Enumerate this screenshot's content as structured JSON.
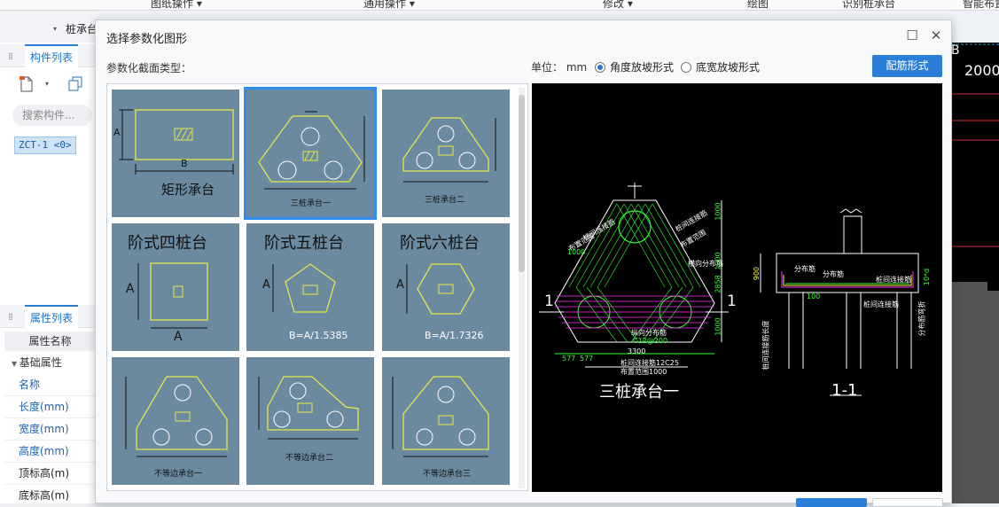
{
  "menubar": {
    "items": [
      "图纸操作",
      "通用操作",
      "修改",
      "绘图",
      "识别桩承台",
      "智能布置"
    ]
  },
  "subbar": {
    "title": "桩承台"
  },
  "left_panel": {
    "component_tab": "构件列表",
    "search_placeholder": "搜索构件...",
    "selected_component": "ZCT-1 <0>",
    "property_tab": "属性列表",
    "property_header": "属性名称",
    "property_group": "基础属性",
    "properties": [
      "名称",
      "长度(mm)",
      "宽度(mm)",
      "高度(mm)",
      "顶标高(m)",
      "底标高(m)"
    ]
  },
  "canvas": {
    "value_label": "2000",
    "axis_label": "B"
  },
  "dialog": {
    "title": "选择参数化图形",
    "section_label": "参数化截面类型：",
    "unit_label": "单位：",
    "unit_value": "mm",
    "radio_angle": "角度放坡形式",
    "radio_width": "底宽放坡形式",
    "rebar_button": "配筋形式",
    "thumbnails": [
      {
        "caption": "矩形承台",
        "dim_a": "A",
        "dim_b": "B"
      },
      {
        "caption": "三桩承台一"
      },
      {
        "caption": "三桩承台二"
      },
      {
        "caption": "阶式四桩台",
        "dim_a": "A",
        "dim_b": "A"
      },
      {
        "caption": "阶式五桩台",
        "dim_a": "A",
        "formula": "B=A/1.5385"
      },
      {
        "caption": "阶式六桩台",
        "dim_a": "A",
        "formula": "B=A/1.7326"
      },
      {
        "caption": "不等边承台一"
      },
      {
        "caption": "不等边承台二"
      },
      {
        "caption": "不等边承台三"
      }
    ],
    "preview": {
      "plan_title": "三桩承台一",
      "section_title": "1-1",
      "section_mark": "1",
      "plan_labels": [
        "桩间连接筋",
        "布置范围",
        "横向分布筋",
        "桩间连接筋",
        "布置范围",
        "纵向分布筋",
        "桩间连接筋12C25",
        "布置范围1000",
        "C12@200"
      ],
      "plan_dims": [
        "1000",
        "1000",
        "2858",
        "1000",
        "577",
        "577",
        "3300",
        "1000"
      ],
      "section_labels": [
        "分布筋",
        "分布筋",
        "桩间连接筋",
        "桩间连接筋",
        "桩间连接筋长度",
        "分布筋弯折"
      ],
      "section_dims": [
        "900",
        "100",
        "10*d"
      ]
    }
  },
  "colors": {
    "accent": "#2b7fd8",
    "thumb_bg": "#6b8aa0",
    "thumb_line": "#e6e64a",
    "cad_green": "#33ff33",
    "cad_magenta": "#ff33ff"
  }
}
